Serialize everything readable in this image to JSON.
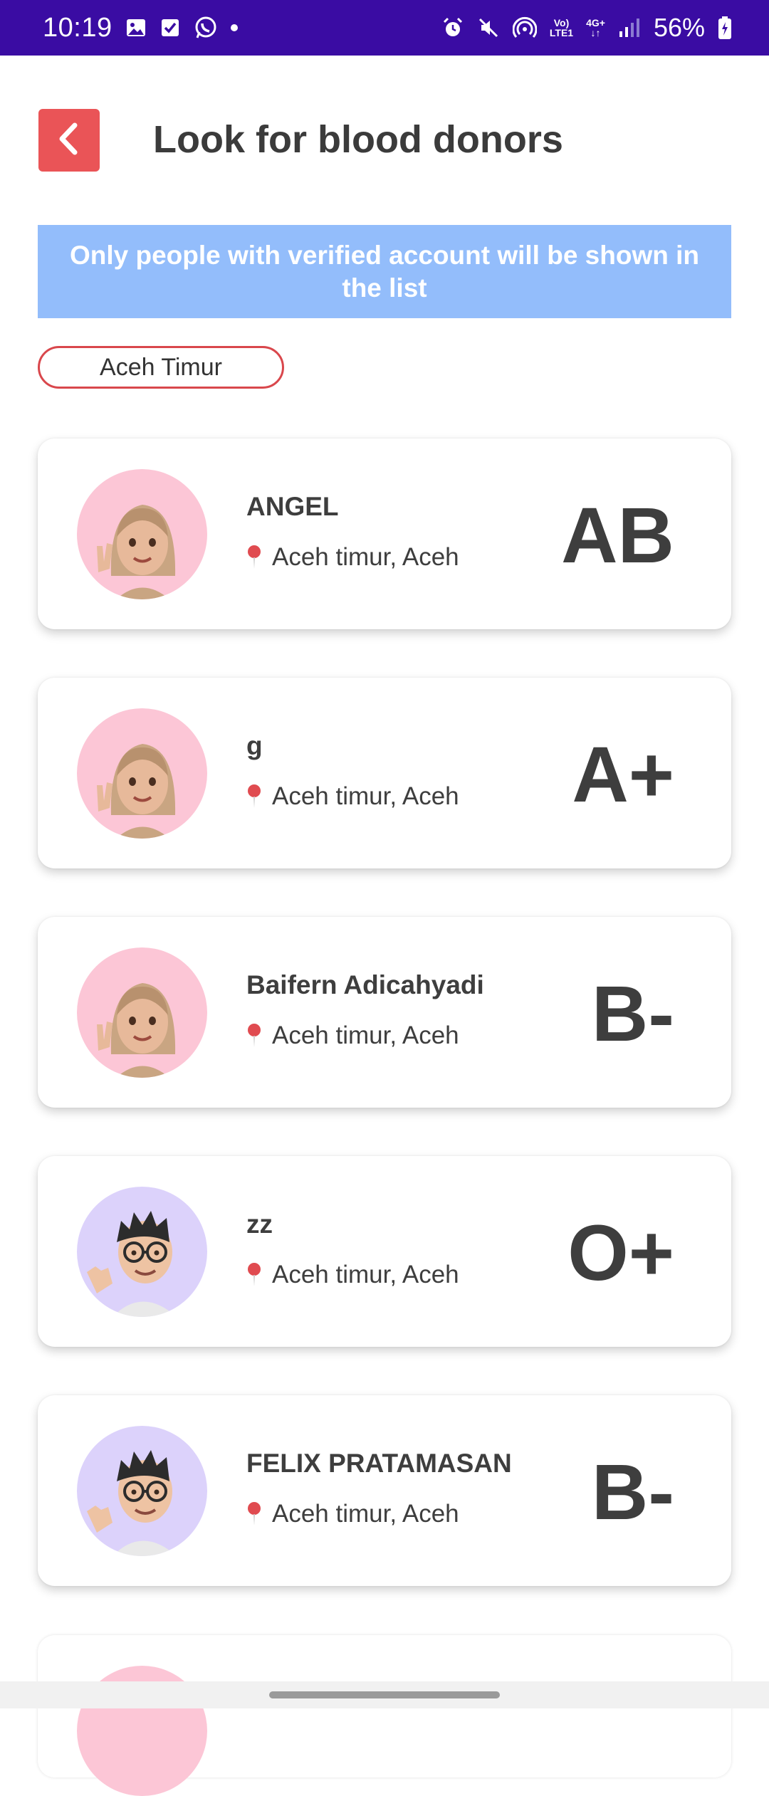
{
  "status_bar": {
    "time": "10:19",
    "network_top": "Vo)",
    "network_bottom": "LTE1",
    "data_top": "4G+",
    "data_bottom": "↓↑",
    "battery": "56%"
  },
  "header": {
    "title": "Look for blood donors"
  },
  "banner": {
    "text": "Only people with verified account will be shown in the list"
  },
  "filter": {
    "location": "Aceh Timur"
  },
  "donors": [
    {
      "name": "ANGEL",
      "location": "Aceh timur, Aceh",
      "blood_type": "AB",
      "avatar": "female-memoji"
    },
    {
      "name": "g",
      "location": "Aceh timur, Aceh",
      "blood_type": "A+",
      "avatar": "female-memoji"
    },
    {
      "name": "Baifern Adicahyadi",
      "location": "Aceh timur, Aceh",
      "blood_type": "B-",
      "avatar": "female-memoji"
    },
    {
      "name": "zz",
      "location": "Aceh timur, Aceh",
      "blood_type": "O+",
      "avatar": "male-memoji"
    },
    {
      "name": "FELIX PRATAMASAN",
      "location": "Aceh timur, Aceh",
      "blood_type": "B-",
      "avatar": "male-memoji"
    }
  ],
  "colors": {
    "status_bar": "#3a0ca3",
    "accent_red": "#ea5457",
    "banner_blue": "#93bdfb",
    "female_avatar_bg": "#fcc6d6",
    "male_avatar_bg": "#dcd2fb"
  }
}
